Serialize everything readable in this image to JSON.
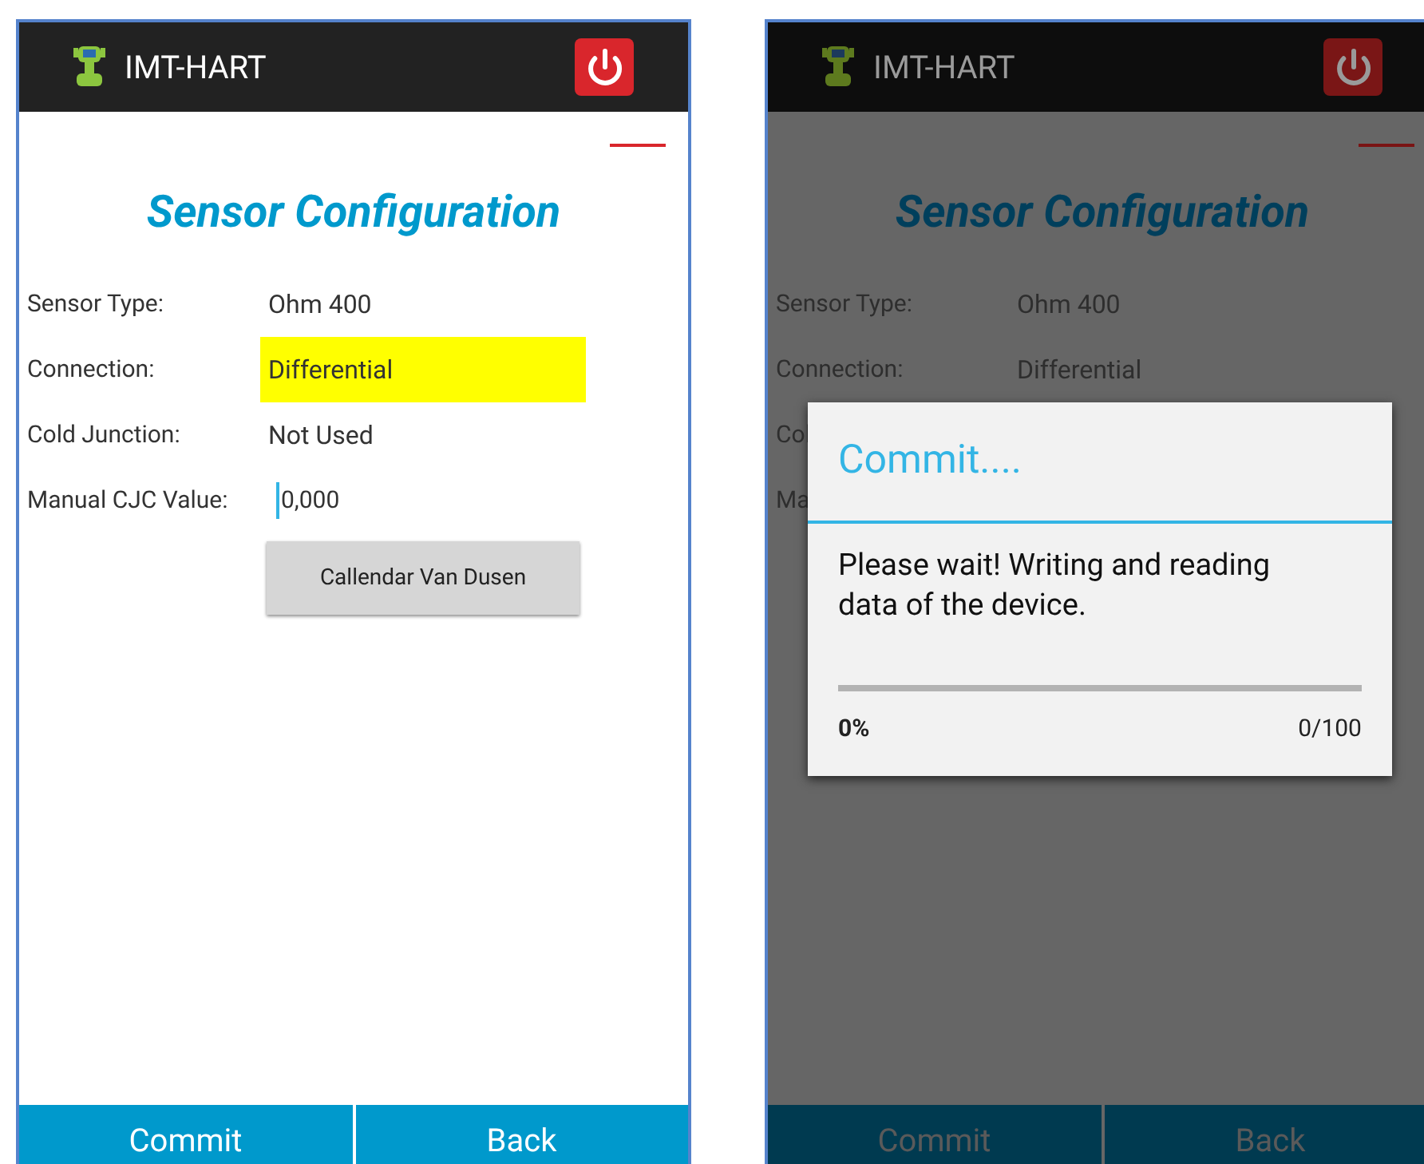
{
  "screens": [
    {
      "app_bar": {
        "title": "IMT-HART"
      },
      "dimmed": false,
      "heading": "Sensor Configuration",
      "fields": [
        {
          "label": "Sensor Type:",
          "value": "Ohm 400",
          "kind": "text",
          "highlighted": false
        },
        {
          "label": "Connection:",
          "value": "Differential",
          "kind": "text",
          "highlighted": true
        },
        {
          "label": "Cold Junction:",
          "value": "Not Used",
          "kind": "text",
          "highlighted": false
        },
        {
          "label": "Manual CJC Value:",
          "value": "0,000",
          "kind": "input",
          "highlighted": false
        }
      ],
      "action_button": "Callendar Van Dusen",
      "footer_buttons": [
        "Commit",
        "Back"
      ]
    },
    {
      "app_bar": {
        "title": "IMT-HART"
      },
      "dimmed": true,
      "heading": "Sensor Configuration",
      "fields": [
        {
          "label": "Sensor Type:",
          "value": "Ohm 400",
          "kind": "text"
        },
        {
          "label": "Connection:",
          "value": "Differential",
          "kind": "text"
        },
        {
          "label": "Col"
        },
        {
          "label": "Ma"
        }
      ],
      "footer_buttons": [
        "Commit",
        "Back"
      ],
      "dialog": {
        "title": "Commit....",
        "message": "Please wait! Writing and reading data of the device.",
        "progress": {
          "level": 0,
          "percent": "0%",
          "count": "0/100"
        }
      }
    }
  ]
}
